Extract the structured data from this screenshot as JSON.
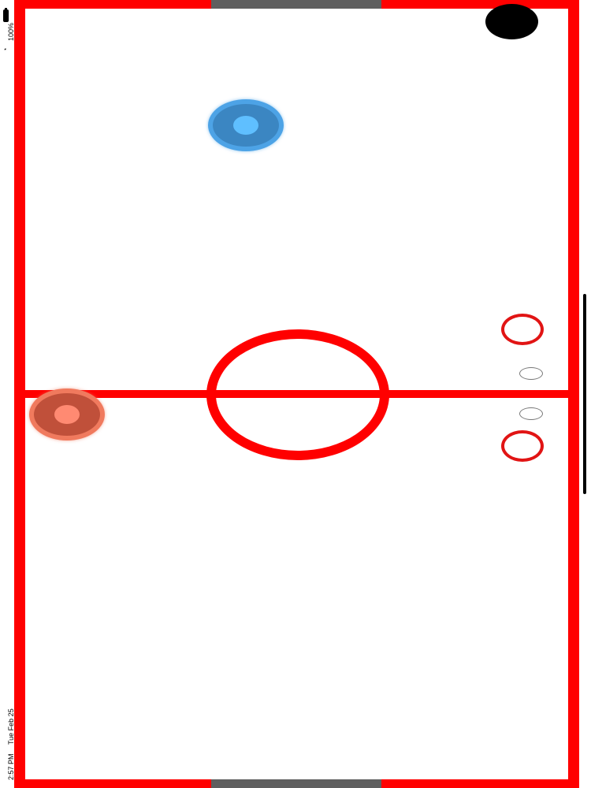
{
  "status_bar": {
    "time": "2:57 PM",
    "date": "Tue Feb 25",
    "battery_percent": "100%",
    "wifi_icon": "wifi-icon",
    "battery_icon": "battery-icon"
  },
  "game": {
    "colors": {
      "wall": "#ff0000",
      "goal": "#5f5f5f",
      "puck": "#000000",
      "blue_paddle": "#3b86c2",
      "red_paddle": "#c0503a",
      "score_ring": "#e11414",
      "rink_surface": "#ffffff"
    },
    "score_markers": {
      "top_player_rings": 1,
      "bottom_player_rings": 1
    }
  }
}
